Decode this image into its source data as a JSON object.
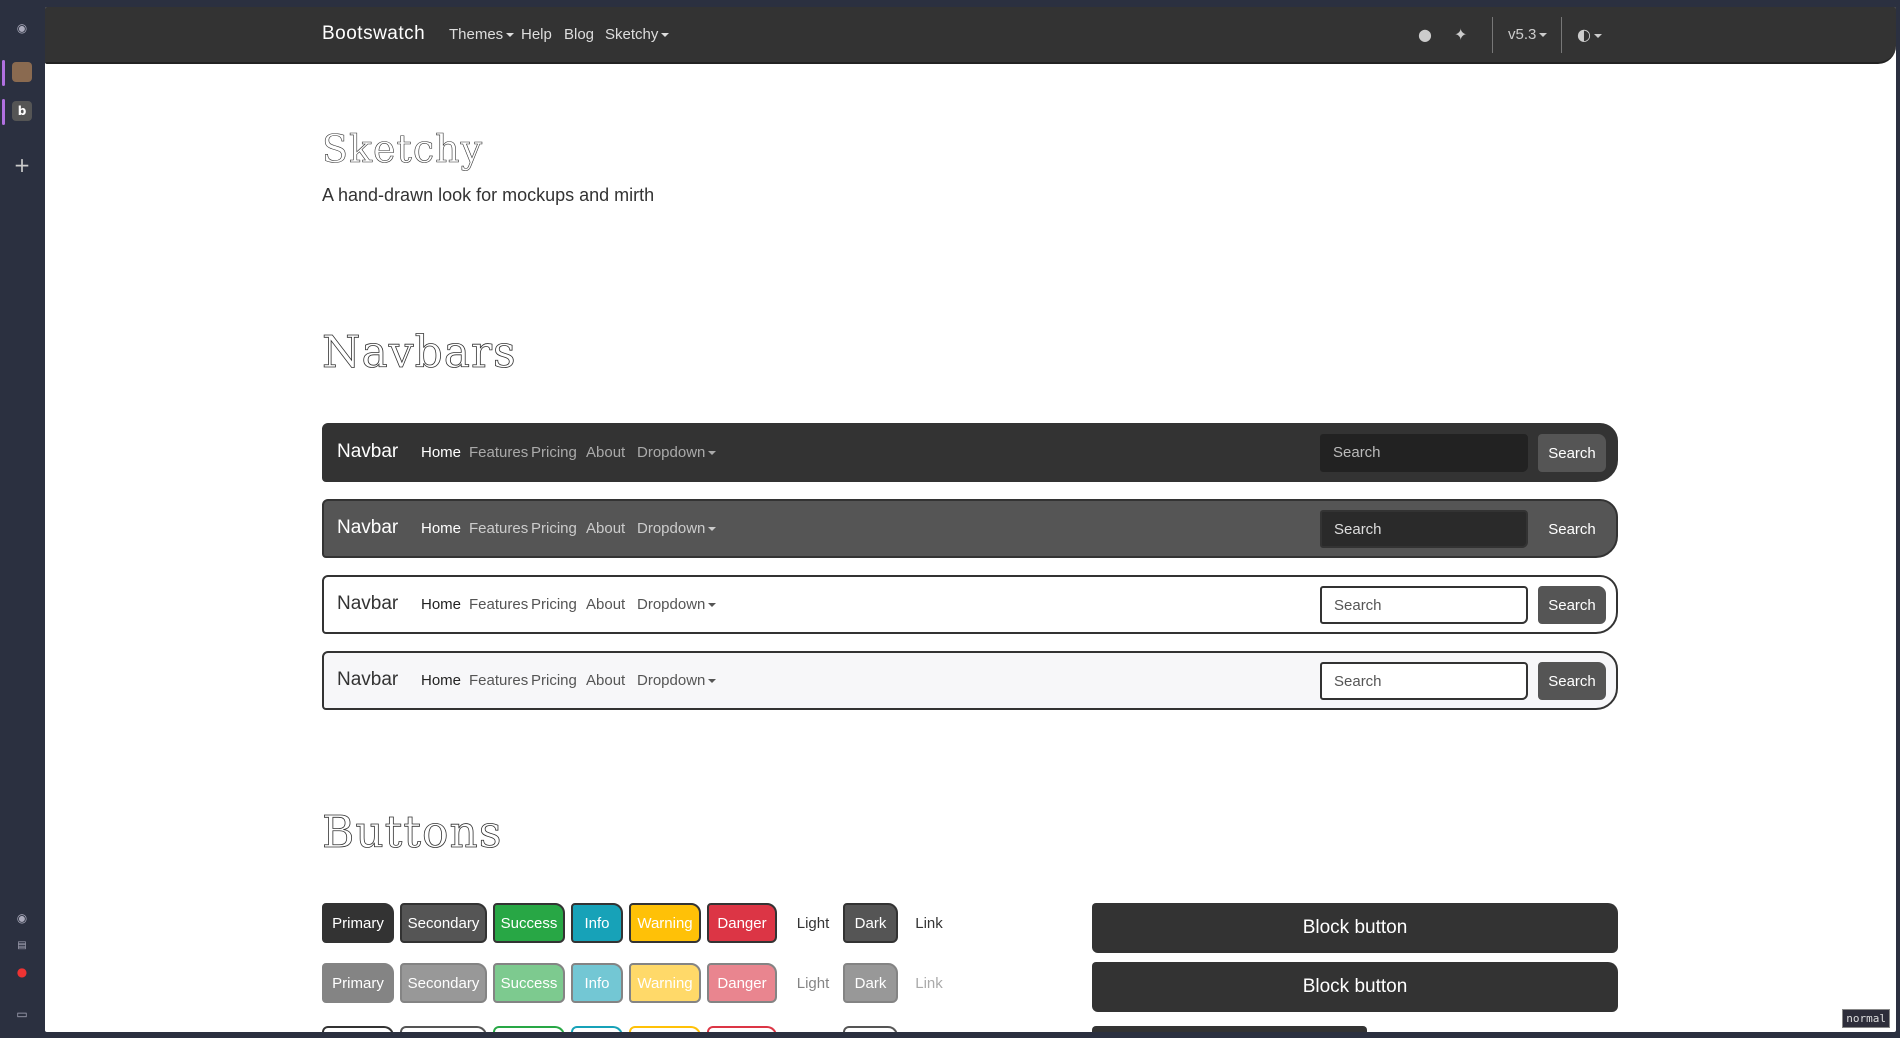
{
  "browser": {
    "mode_label": "normal"
  },
  "topnav": {
    "brand": "Bootswatch",
    "links": [
      "Themes",
      "Help",
      "Blog",
      "Sketchy"
    ],
    "version": "v5.3"
  },
  "hero": {
    "title": "Sketchy",
    "subtitle": "A hand-drawn look for mockups and mirth"
  },
  "navbars": {
    "title": "Navbars",
    "brand": "Navbar",
    "links": [
      "Home",
      "Features",
      "Pricing",
      "About",
      "Dropdown"
    ],
    "search_placeholder": "Search",
    "search_button": "Search"
  },
  "buttons": {
    "title": "Buttons",
    "labels": [
      "Primary",
      "Secondary",
      "Success",
      "Info",
      "Warning",
      "Danger",
      "Light",
      "Dark",
      "Link"
    ],
    "block_label": "Block button",
    "colors": {
      "primary": "#333333",
      "secondary": "#555555",
      "success": "#28a745",
      "info": "#17a2b8",
      "warning": "#ffc107",
      "danger": "#dc3545",
      "dark": "#555555"
    }
  }
}
